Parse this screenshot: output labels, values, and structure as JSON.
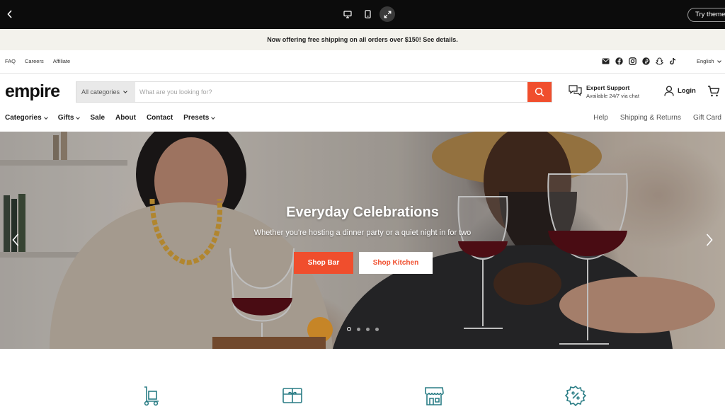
{
  "preview": {
    "try_theme_label": "Try theme",
    "devices": [
      "desktop-icon",
      "mobile-icon",
      "fullscreen-icon"
    ]
  },
  "announcement": {
    "text": "Now offering free shipping on all orders over $150! See details."
  },
  "utility": {
    "links": [
      "FAQ",
      "Careers",
      "Affiliate"
    ],
    "social_icons": [
      "email-icon",
      "facebook-icon",
      "instagram-icon",
      "pinterest-icon",
      "snapchat-icon",
      "tiktok-icon"
    ],
    "language": "English"
  },
  "header": {
    "logo": "empire",
    "search": {
      "category": "All categories",
      "placeholder": "What are you looking for?"
    },
    "support": {
      "title": "Expert Support",
      "subtitle": "Available 24/7 via chat"
    },
    "login_label": "Login"
  },
  "nav": {
    "items": [
      {
        "label": "Categories",
        "dropdown": true
      },
      {
        "label": "Gifts",
        "dropdown": true
      },
      {
        "label": "Sale",
        "dropdown": false
      },
      {
        "label": "About",
        "dropdown": false
      },
      {
        "label": "Contact",
        "dropdown": false
      },
      {
        "label": "Presets",
        "dropdown": true
      }
    ],
    "right_items": [
      "Help",
      "Shipping & Returns",
      "Gift Card"
    ]
  },
  "hero": {
    "title": "Everyday Celebrations",
    "subtitle": "Whether you're hosting a dinner party or a quiet night in for two",
    "buttons": [
      "Shop Bar",
      "Shop Kitchen"
    ],
    "slide_count": 4,
    "active_slide": 1
  },
  "features": {
    "icons": [
      "hand-truck-icon",
      "gift-card-icon",
      "storefront-icon",
      "discount-badge-icon"
    ]
  },
  "colors": {
    "accent": "#f04e2d",
    "announcement_bg": "#f3f2ec",
    "preview_bar": "#0c0c0c",
    "feature_icon": "#2a7d85"
  }
}
